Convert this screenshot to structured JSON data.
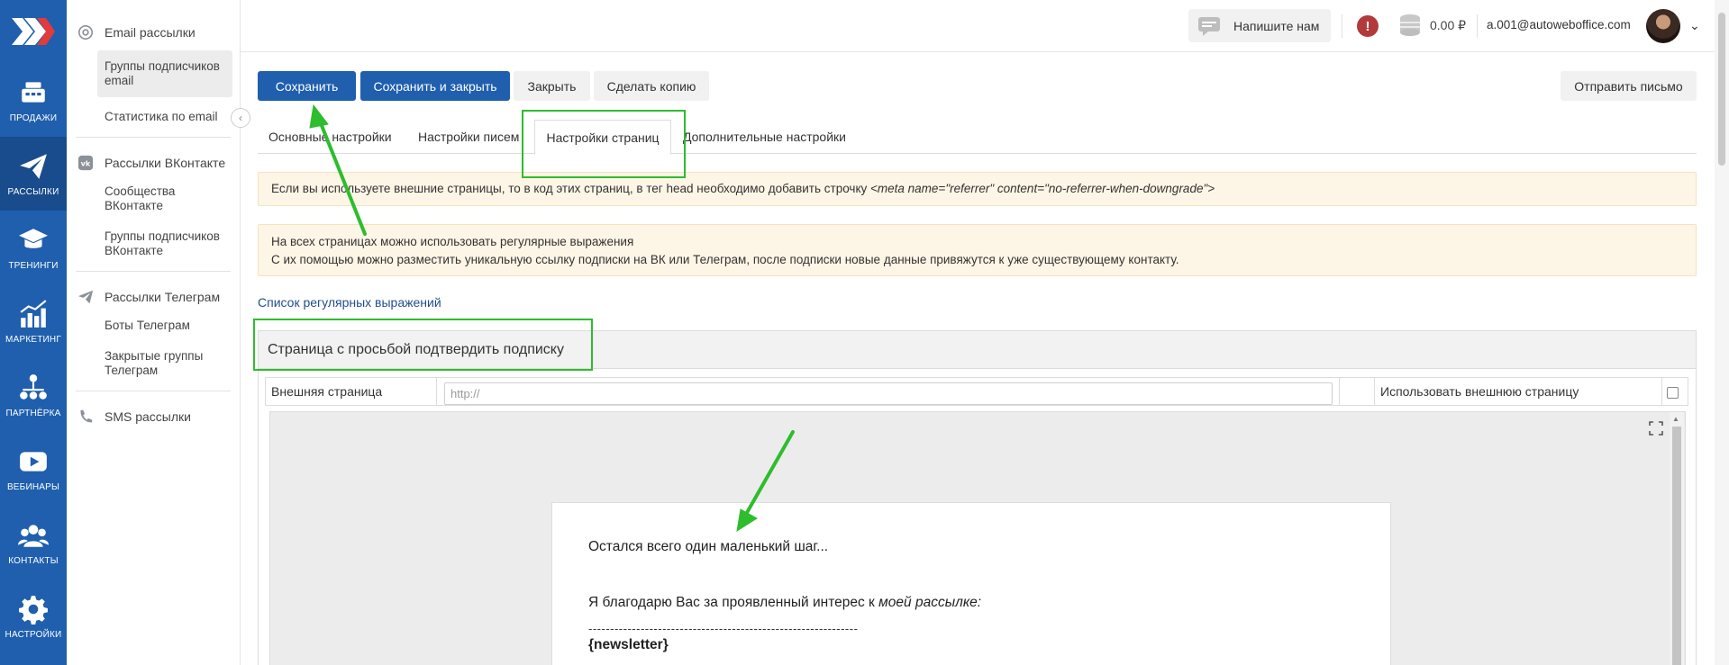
{
  "colors": {
    "brand": "#1f5fae",
    "brand_dark": "#184c8d",
    "annotation": "#2dbd2d",
    "alert_bg": "#fdf5e6",
    "danger": "#b33a3a"
  },
  "rail": {
    "items": [
      {
        "label": "ПРОДАЖИ",
        "icon": "cash-register-icon"
      },
      {
        "label": "РАССЫЛКИ",
        "icon": "paper-plane-icon"
      },
      {
        "label": "ТРЕНИНГИ",
        "icon": "graduation-cap-icon"
      },
      {
        "label": "МАРКЕТИНГ",
        "icon": "chart-growth-icon"
      },
      {
        "label": "ПАРТНЁРКА",
        "icon": "partner-network-icon"
      },
      {
        "label": "ВЕБИНАРЫ",
        "icon": "video-play-icon"
      },
      {
        "label": "КОНТАКТЫ",
        "icon": "people-icon"
      },
      {
        "label": "НАСТРОЙКИ",
        "icon": "gear-icon"
      }
    ]
  },
  "submenu": {
    "email_group": "Email рассылки",
    "email_items": [
      "Группы подписчиков email",
      "Статистика по email"
    ],
    "vk_group": "Рассылки ВКонтакте",
    "vk_items": [
      "Сообщества ВКонтакте",
      "Группы подписчиков ВКонтакте"
    ],
    "tg_group": "Рассылки Телеграм",
    "tg_items": [
      "Боты Телеграм",
      "Закрытые группы Телеграм"
    ],
    "sms_group": "SMS рассылки"
  },
  "header": {
    "write_label": "Напишите нам",
    "balance": "0.00 ₽",
    "email": "a.001@autoweboffice.com",
    "alert_glyph": "!"
  },
  "toolbar": {
    "save": "Сохранить",
    "save_close": "Сохранить и закрыть",
    "close": "Закрыть",
    "copy": "Сделать копию",
    "send": "Отправить письмо"
  },
  "tabs": {
    "main": "Основные настройки",
    "letters": "Настройки писем",
    "pages": "Настройки страниц",
    "extra": "Дополнительные настройки"
  },
  "alerts": {
    "referrer_text": "Если вы используете внешние страницы, то в код этих страниц, в тег head необходимо добавить строчку ",
    "referrer_code": "<meta name=\"referrer\" content=\"no-referrer-when-downgrade\">",
    "regex_line1": "На всех страницах можно использовать регулярные выражения",
    "regex_line2": "С их помощью можно разместить уникальную ссылку подписки на ВК или Телеграм, после подписки новые данные привяжутся к уже существующему контакту."
  },
  "regex_link": "Список регулярных выражений",
  "panel": {
    "title": "Страница с просьбой подтвердить подписку",
    "external_label": "Внешняя страница",
    "url_placeholder": "http://",
    "use_external_label": "Использовать внешнюю страницу",
    "use_external_checked": false
  },
  "editor": {
    "line1": "Остался всего один маленький шаг...",
    "line2_prefix": "Я благодарю Вас за проявленный интерес к ",
    "line2_em": "моей рассылке:",
    "dashes": "--------------------------------------------------------------",
    "tag": "{newsletter}"
  }
}
